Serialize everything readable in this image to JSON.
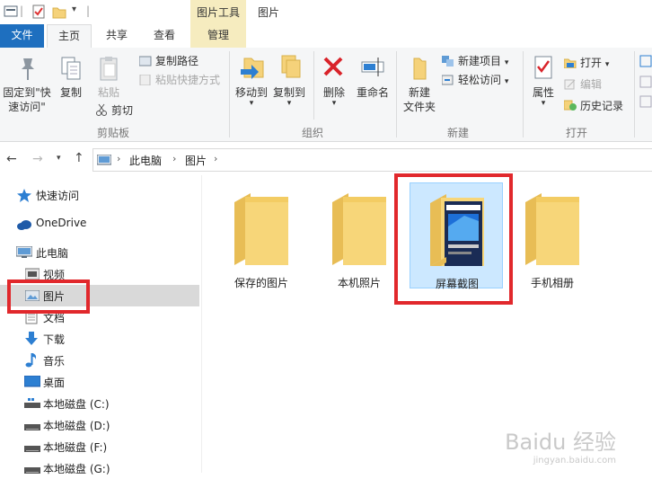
{
  "title_bar": {
    "contextual_tab": "图片工具",
    "window_title": "图片"
  },
  "tabs": {
    "file": "文件",
    "home": "主页",
    "share": "共享",
    "view": "查看",
    "manage": "管理"
  },
  "ribbon": {
    "clipboard": {
      "pin": "固定到\"快",
      "pin2": "速访问\"",
      "copy": "复制",
      "paste": "粘贴",
      "copy_path": "复制路径",
      "paste_shortcut": "粘贴快捷方式",
      "cut": "剪切",
      "group": "剪贴板"
    },
    "organize": {
      "move_to": "移动到",
      "copy_to": "复制到",
      "delete": "删除",
      "rename": "重命名",
      "group": "组织"
    },
    "new": {
      "new_folder": "新建",
      "new_folder2": "文件夹",
      "new_item": "新建项目",
      "easy_access": "轻松访问",
      "group": "新建"
    },
    "open": {
      "properties": "属性",
      "open": "打开",
      "edit": "编辑",
      "history": "历史记录",
      "group": "打开"
    }
  },
  "address": {
    "crumbs": [
      "此电脑",
      "图片"
    ]
  },
  "nav": {
    "items": [
      {
        "label": "快速访问",
        "icon": "star-icon"
      },
      {
        "label": "OneDrive",
        "icon": "cloud-icon"
      },
      {
        "label": "此电脑",
        "icon": "computer-icon"
      },
      {
        "label": "视频",
        "icon": "video-folder-icon"
      },
      {
        "label": "图片",
        "icon": "pictures-folder-icon"
      },
      {
        "label": "文档",
        "icon": "documents-folder-icon"
      },
      {
        "label": "下载",
        "icon": "download-icon"
      },
      {
        "label": "音乐",
        "icon": "music-icon"
      },
      {
        "label": "桌面",
        "icon": "desktop-icon"
      },
      {
        "label": "本地磁盘 (C:)",
        "icon": "drive-icon"
      },
      {
        "label": "本地磁盘 (D:)",
        "icon": "drive-icon"
      },
      {
        "label": "本地磁盘 (F:)",
        "icon": "drive-icon"
      },
      {
        "label": "本地磁盘 (G:)",
        "icon": "drive-icon"
      }
    ]
  },
  "folders": [
    {
      "label": "保存的图片"
    },
    {
      "label": "本机照片"
    },
    {
      "label": "屏幕截图"
    },
    {
      "label": "手机相册"
    }
  ],
  "watermark": {
    "brand": "Baidu 经验",
    "url": "jingyan.baidu.com"
  },
  "colors": {
    "accent": "#1e6fbf",
    "highlight_box": "#e1282c",
    "folder": "#f5d27a",
    "selection": "#cce8ff"
  }
}
